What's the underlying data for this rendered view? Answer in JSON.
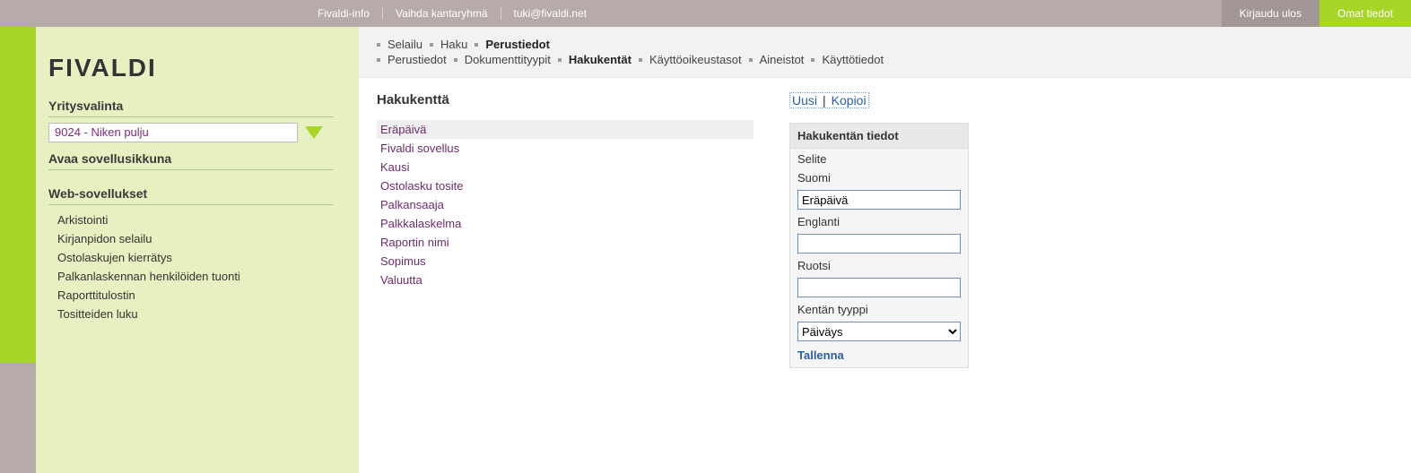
{
  "topbar": {
    "info": "Fivaldi-info",
    "switch_group": "Vaihda kantaryhmä",
    "support_email": "tuki@fivaldi.net",
    "logout": "Kirjaudu ulos",
    "own_info": "Omat tiedot"
  },
  "sidebar": {
    "logo": "FIVALDI",
    "company_heading": "Yritysvalinta",
    "company_value": "9024 - Niken pulju",
    "open_app_window": "Avaa sovellusikkuna",
    "web_apps_heading": "Web-sovellukset",
    "web_apps": [
      "Arkistointi",
      "Kirjanpidon selailu",
      "Ostolaskujen kierrätys",
      "Palkanlaskennan henkilöiden tuonti",
      "Raporttitulostin",
      "Tositteiden luku"
    ]
  },
  "breadcrumbs": {
    "row1": [
      {
        "label": "Selailu",
        "current": false
      },
      {
        "label": "Haku",
        "current": false
      },
      {
        "label": "Perustiedot",
        "current": true
      }
    ],
    "row2": [
      {
        "label": "Perustiedot",
        "current": false
      },
      {
        "label": "Dokumenttityypit",
        "current": false
      },
      {
        "label": "Hakukentät",
        "current": true
      },
      {
        "label": "Käyttöoikeustasot",
        "current": false
      },
      {
        "label": "Aineistot",
        "current": false
      },
      {
        "label": "Käyttötiedot",
        "current": false
      }
    ]
  },
  "list": {
    "title": "Hakukenttä",
    "items": [
      "Eräpäivä",
      "Fivaldi sovellus",
      "Kausi",
      "Ostolasku tosite",
      "Palkansaaja",
      "Palkkalaskelma",
      "Raportin nimi",
      "Sopimus",
      "Valuutta"
    ],
    "active_index": 0
  },
  "actions": {
    "new": "Uusi",
    "copy": "Kopioi",
    "sep": "|"
  },
  "form": {
    "heading": "Hakukentän tiedot",
    "selite_label": "Selite",
    "suomi_label": "Suomi",
    "suomi_value": "Eräpäivä",
    "englanti_label": "Englanti",
    "englanti_value": "",
    "ruotsi_label": "Ruotsi",
    "ruotsi_value": "",
    "type_label": "Kentän tyyppi",
    "type_value": "Päiväys",
    "save": "Tallenna"
  }
}
